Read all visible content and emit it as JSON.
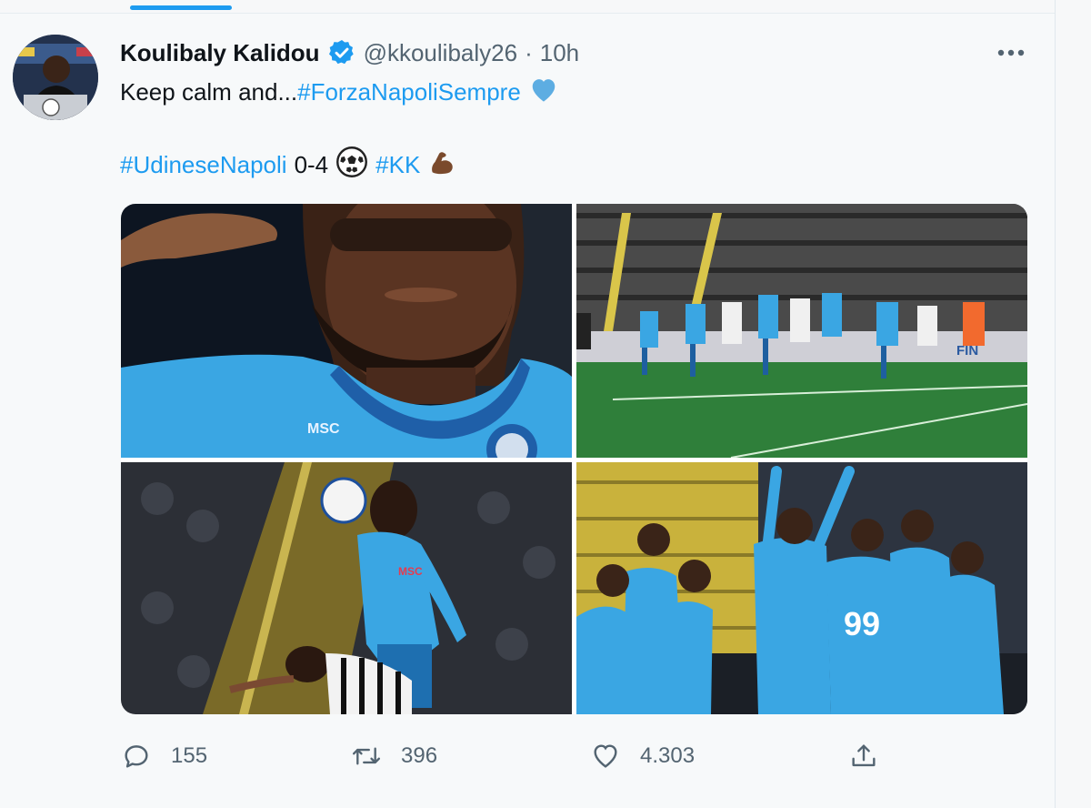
{
  "tweet": {
    "display_name": "Koulibaly Kalidou",
    "verified_icon": "verified-badge-icon",
    "handle": "@kkoulibaly26",
    "separator": "·",
    "time": "10h",
    "more_icon": "more-options-icon",
    "line1": {
      "text": "Keep calm and...",
      "hashtag": "#ForzaNapoliSempre",
      "emoji_icon": "blue-heart-icon"
    },
    "line2": {
      "hashtag1": "#UdineseNapoli",
      "score": "0-4",
      "emoji_icon": "soccer-ball-icon",
      "hashtag2": "#KK",
      "emoji2_icon": "flexed-biceps-icon"
    },
    "photos": [
      {
        "name": "photo-koulibaly-portrait",
        "jersey": "MSC"
      },
      {
        "name": "photo-match-goalmouth",
        "board_text": "FIN"
      },
      {
        "name": "photo-heading-ball",
        "jersey": "MSC"
      },
      {
        "name": "photo-team-celebration",
        "jersey_number": "99"
      }
    ]
  },
  "actions": {
    "reply": {
      "icon": "reply-icon",
      "count": "155"
    },
    "retweet": {
      "icon": "retweet-icon",
      "count": "396"
    },
    "like": {
      "icon": "heart-icon",
      "count": "4.303"
    },
    "share": {
      "icon": "share-icon"
    }
  },
  "colors": {
    "link": "#1d9bf0",
    "secondary_text": "#536471",
    "napoli_blue": "#3aa6e3",
    "pitch_green": "#2f7f3a"
  }
}
